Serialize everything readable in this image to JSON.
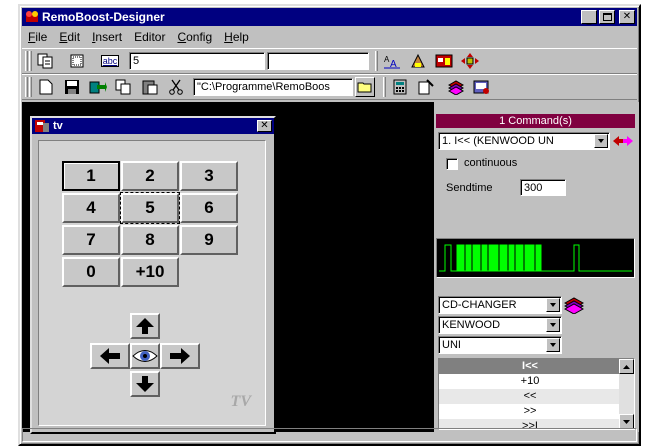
{
  "app": {
    "title": "RemoBoost-Designer"
  },
  "menu": [
    {
      "label": "File",
      "u": "F",
      "rest": "ile"
    },
    {
      "label": "Edit",
      "u": "E",
      "rest": "dit"
    },
    {
      "label": "Insert",
      "u": "I",
      "rest": "nsert"
    },
    {
      "label": "Editor",
      "u": "",
      "rest": "Editor"
    },
    {
      "label": "Config",
      "u": "C",
      "rest": "onfig"
    },
    {
      "label": "Help",
      "u": "H",
      "rest": "elp"
    }
  ],
  "toolbar1": {
    "abc_label": "abc",
    "number_value": "5",
    "text_value": ""
  },
  "toolbar2": {
    "path_value": "\"C:\\Programme\\RemoBoos"
  },
  "child": {
    "title": "tv",
    "tv_logo": "TV"
  },
  "keys": [
    "1",
    "2",
    "3",
    "4",
    "5",
    "6",
    "7",
    "8",
    "9",
    "0",
    "+10"
  ],
  "command": {
    "header": "1 Command(s)",
    "selected": "1. I<< (KENWOOD UN",
    "continuous_label": "continuous",
    "sendtime_label": "Sendtime",
    "sendtime_value": "300"
  },
  "device": {
    "type": "CD-CHANGER",
    "brand": "KENWOOD",
    "model": "UNI"
  },
  "commands_list": [
    "I<<",
    "+10",
    "<<",
    ">>",
    ">>I"
  ],
  "colors": {
    "title_bar": "#000080",
    "command_header": "#800040",
    "scope_signal": "#00ff00"
  }
}
